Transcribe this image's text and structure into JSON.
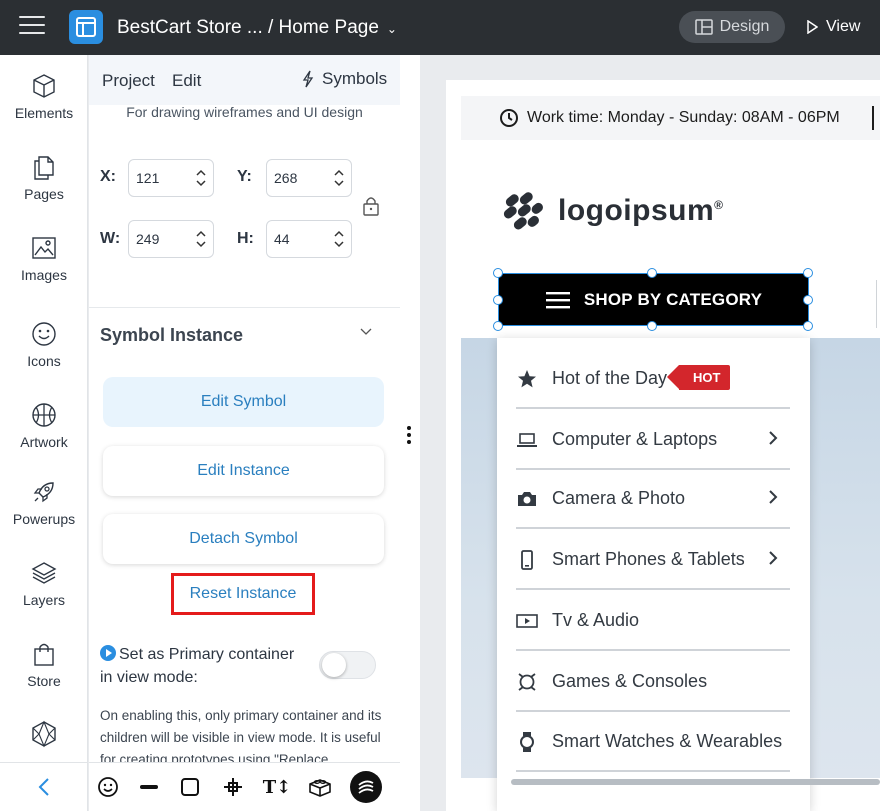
{
  "topbar": {
    "breadcrumb": "BestCart Store ... / Home Page",
    "design_label": "Design",
    "view_label": "View"
  },
  "rail": {
    "items": [
      {
        "label": "Elements",
        "icon": "cube-icon"
      },
      {
        "label": "Pages",
        "icon": "pages-icon"
      },
      {
        "label": "Images",
        "icon": "image-icon"
      },
      {
        "label": "Icons",
        "icon": "smiley-icon"
      },
      {
        "label": "Artwork",
        "icon": "basketball-icon"
      },
      {
        "label": "Powerups",
        "icon": "rocket-icon"
      },
      {
        "label": "Layers",
        "icon": "layers-icon"
      },
      {
        "label": "Store",
        "icon": "bag-icon"
      }
    ]
  },
  "panel": {
    "tab_project": "Project",
    "tab_edit": "Edit",
    "tab_symbols": "Symbols",
    "subtitle": "For drawing wireframes and UI design",
    "x_label": "X:",
    "x_value": "121",
    "y_label": "Y:",
    "y_value": "268",
    "w_label": "W:",
    "w_value": "249",
    "h_label": "H:",
    "h_value": "44",
    "section_title": "Symbol Instance",
    "edit_symbol": "Edit Symbol",
    "edit_instance": "Edit Instance",
    "detach_symbol": "Detach Symbol",
    "reset_instance": "Reset Instance",
    "primary_label": "Set as Primary container in view mode:",
    "help_text": "On enabling this, only primary container and its children will be visible in view mode. It is useful for creating prototypes using \"Replace"
  },
  "canvas": {
    "worktime": "Work time: Monday - Sunday: 08AM - 06PM",
    "logo_text": "logoipsum",
    "logo_mark": "®",
    "shop_label": "SHOP BY CATEGORY",
    "hot_badge": "HOT",
    "menu_items": [
      {
        "label": "Hot of the Day",
        "icon": "star-icon",
        "arrow": false
      },
      {
        "label": "Computer & Laptops",
        "icon": "laptop-icon",
        "arrow": true
      },
      {
        "label": "Camera & Photo",
        "icon": "camera-icon",
        "arrow": true
      },
      {
        "label": "Smart Phones & Tablets",
        "icon": "phone-icon",
        "arrow": true
      },
      {
        "label": "Tv & Audio",
        "icon": "tv-icon",
        "arrow": false
      },
      {
        "label": "Games & Consoles",
        "icon": "gamepad-icon",
        "arrow": false
      },
      {
        "label": "Smart Watches & Wearables",
        "icon": "watch-icon",
        "arrow": false
      }
    ]
  },
  "colors": {
    "accent": "#2a8ee0",
    "highlight": "#e41b1b",
    "topbar": "#2b2f33",
    "hot": "#d3262c"
  }
}
